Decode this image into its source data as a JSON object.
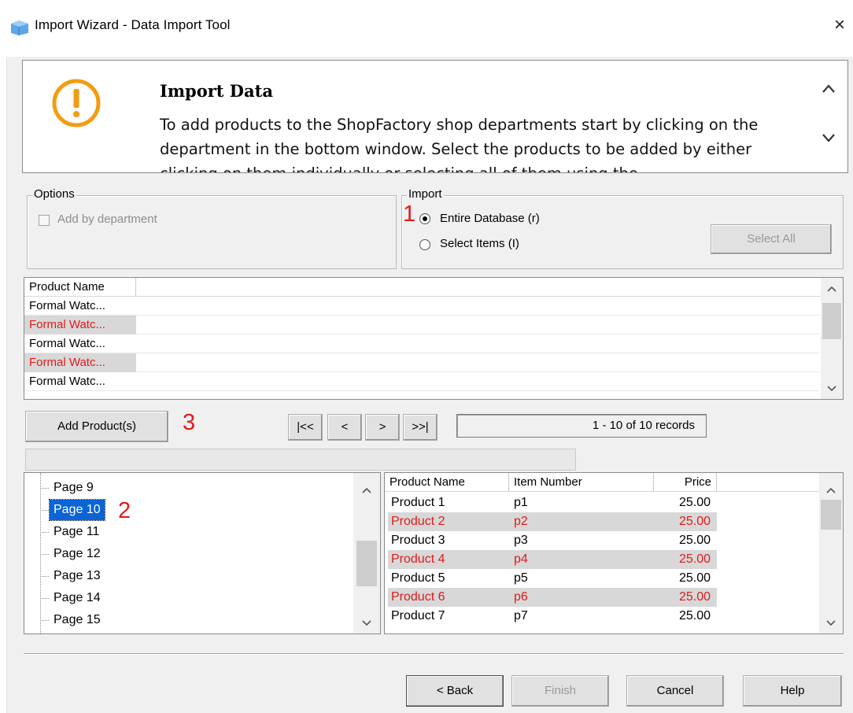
{
  "window": {
    "title": "Import Wizard - Data Import Tool",
    "close_symbol": "×",
    "app_icon": "import-wizard-icon"
  },
  "header": {
    "icon": "warning-icon",
    "title": "Import Data",
    "text": "To add products to the ShopFactory shop departments start by clicking on the department in the bottom window. Select the products to be added by either clicking on them individually or selecting all of them using the"
  },
  "options": {
    "legend": "Options",
    "add_by_department": {
      "label": "Add by department",
      "checked": false,
      "disabled": true
    }
  },
  "import": {
    "legend": "Import",
    "entire_database": {
      "label": "Entire Database (r)",
      "selected": true
    },
    "select_items": {
      "label": "Select Items (I)",
      "selected": false
    },
    "select_all_label": "Select All"
  },
  "product_list": {
    "header": "Product Name",
    "rows": [
      "Formal Watc...",
      "Formal Watc...",
      "Formal Watc...",
      "Formal Watc...",
      "Formal Watc..."
    ]
  },
  "annotations": {
    "one": "1",
    "two": "2",
    "three": "3"
  },
  "controls": {
    "add_products_label": "Add Product(s)",
    "first_label": "|<<",
    "prev_label": "<",
    "next_label": ">",
    "last_label": ">>|",
    "records_text": "1 - 10 of 10 records"
  },
  "tree": {
    "items": [
      "Page 9",
      "Page 10",
      "Page 11",
      "Page 12",
      "Page 13",
      "Page 14",
      "Page 15"
    ],
    "selected_index": 1
  },
  "product_table": {
    "columns": [
      "Product Name",
      "Item Number",
      "Price"
    ],
    "rows": [
      [
        "Product 1",
        "p1",
        "25.00"
      ],
      [
        "Product 2",
        "p2",
        "25.00"
      ],
      [
        "Product 3",
        "p3",
        "25.00"
      ],
      [
        "Product 4",
        "p4",
        "25.00"
      ],
      [
        "Product 5",
        "p5",
        "25.00"
      ],
      [
        "Product 6",
        "p6",
        "25.00"
      ],
      [
        "Product 7",
        "p7",
        "25.00"
      ]
    ]
  },
  "footer": {
    "back_label": "< Back",
    "finish_label": "Finish",
    "cancel_label": "Cancel",
    "help_label": "Help"
  },
  "colors": {
    "highlight_text": "#e01b1b",
    "highlight_row": "#d8d8d8",
    "selection": "#0a64d6",
    "warning": "#f39c12"
  }
}
